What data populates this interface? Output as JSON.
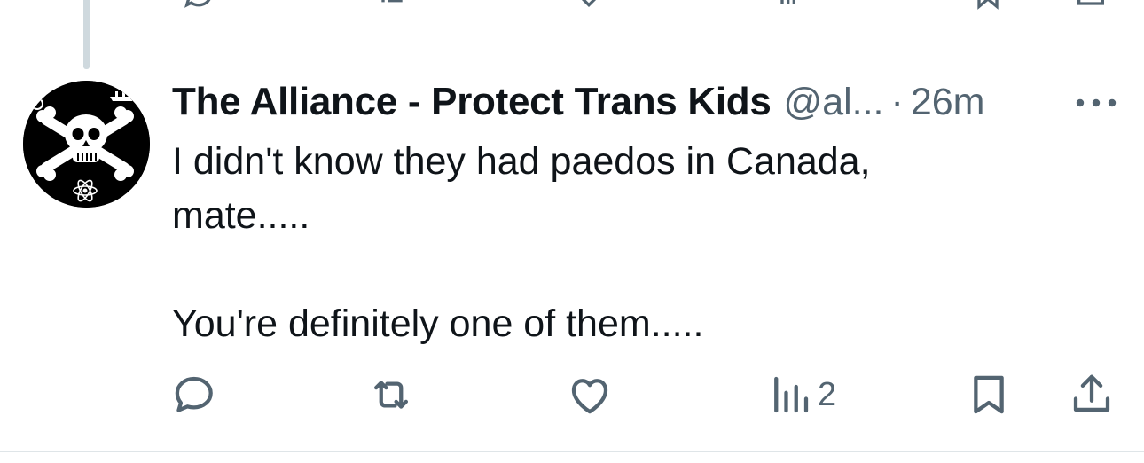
{
  "tweet": {
    "display_name": "The Alliance - Protect Trans Kids",
    "handle": "@al...",
    "separator": "·",
    "time": "26m",
    "text_line1": "I didn't know they had paedos in Canada,",
    "text_line2": "mate.....",
    "text_line3": "You're definitely one of them.....",
    "views_count": "2"
  },
  "icons": {
    "avatar": "skull-crossbones-avatar",
    "more": "more-icon",
    "reply": "reply-icon",
    "retweet": "retweet-icon",
    "like": "like-icon",
    "views": "views-icon",
    "bookmark": "bookmark-icon",
    "share": "share-icon"
  },
  "colors": {
    "text_primary": "#0f1419",
    "text_secondary": "#536471",
    "thread_line": "#cfd9de"
  }
}
